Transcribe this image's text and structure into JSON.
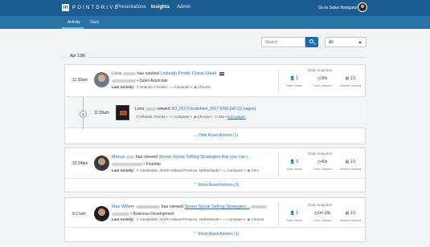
{
  "app": {
    "logo_letters": "in",
    "brand": "POINTDRIVE"
  },
  "nav": {
    "items": [
      "Presentations",
      "Insights",
      "Admin"
    ],
    "active": "Insights",
    "sales_navigator": "Go to Sales Navigator"
  },
  "subnav": {
    "tabs": [
      "Activity",
      "Stats"
    ],
    "active": "Activity"
  },
  "filters": {
    "search_placeholder": "Search",
    "select_value": "All"
  },
  "date_label": "Apr 13th",
  "snapshot": {
    "title": "Daily Snapshot",
    "labels": [
      "Total Views",
      "Time Viewed",
      "Assets Viewed"
    ]
  },
  "cards": [
    {
      "time": "11:39am",
      "name": "Lena",
      "verb": "has viewed",
      "item": "LinkedIn Profile Cheat Sheet",
      "title": "Sales Associate",
      "last_activity_label": "Last Activity:",
      "location": "Orlando, Florida",
      "device": "Computer",
      "browser": "Chrome",
      "stats": {
        "views": "1",
        "time": "30s",
        "assets": "1/1"
      },
      "sub": {
        "time": "11:39am",
        "name": "Lena",
        "verb": "viewed",
        "item": "SO_2017cheatsheet_2017 ENG.pdf (12 pages)",
        "location": "Orlando, Florida",
        "device": "Computer",
        "browser": "Chrome",
        "duration": "23s",
        "pages": "5/12 pages"
      },
      "action": "Hide Asset Actions (1)"
    },
    {
      "time": "10:24am",
      "name": "Manus",
      "verb": "has viewed",
      "item": "Seven Social Selling Strategies that you can i...",
      "title": "Founder",
      "last_activity_label": "Last Activity:",
      "location": "Amsterdam, North Holland Province, Netherlands",
      "device": "Computer",
      "browser": "Chro",
      "stats": {
        "views": "2",
        "time": "40s",
        "assets": "1/1"
      },
      "action": "Show Asset Actions (3)"
    },
    {
      "time": "9:17am",
      "name": "Max Willem",
      "verb": "has viewed",
      "item": "Seven Social Selling Strategies...",
      "title": "Business Development",
      "last_activity_label": "Last Activity:",
      "location": "Amsterdam, North Holland Province, Netherlands",
      "device": "Computer",
      "browser": "Chrome",
      "stats": {
        "views": "1",
        "time": "1m 18s",
        "assets": "1/1"
      },
      "action": "Show Asset Actions (1)"
    }
  ]
}
